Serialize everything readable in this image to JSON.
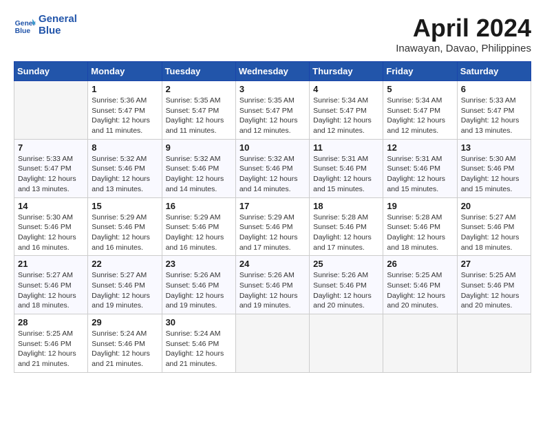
{
  "header": {
    "logo_line1": "General",
    "logo_line2": "Blue",
    "month": "April 2024",
    "location": "Inawayan, Davao, Philippines"
  },
  "weekdays": [
    "Sunday",
    "Monday",
    "Tuesday",
    "Wednesday",
    "Thursday",
    "Friday",
    "Saturday"
  ],
  "weeks": [
    [
      {
        "day": "",
        "empty": true
      },
      {
        "day": "1",
        "sunrise": "5:36 AM",
        "sunset": "5:47 PM",
        "daylight": "12 hours and 11 minutes."
      },
      {
        "day": "2",
        "sunrise": "5:35 AM",
        "sunset": "5:47 PM",
        "daylight": "12 hours and 11 minutes."
      },
      {
        "day": "3",
        "sunrise": "5:35 AM",
        "sunset": "5:47 PM",
        "daylight": "12 hours and 12 minutes."
      },
      {
        "day": "4",
        "sunrise": "5:34 AM",
        "sunset": "5:47 PM",
        "daylight": "12 hours and 12 minutes."
      },
      {
        "day": "5",
        "sunrise": "5:34 AM",
        "sunset": "5:47 PM",
        "daylight": "12 hours and 12 minutes."
      },
      {
        "day": "6",
        "sunrise": "5:33 AM",
        "sunset": "5:47 PM",
        "daylight": "12 hours and 13 minutes."
      }
    ],
    [
      {
        "day": "7",
        "sunrise": "5:33 AM",
        "sunset": "5:47 PM",
        "daylight": "12 hours and 13 minutes."
      },
      {
        "day": "8",
        "sunrise": "5:32 AM",
        "sunset": "5:46 PM",
        "daylight": "12 hours and 13 minutes."
      },
      {
        "day": "9",
        "sunrise": "5:32 AM",
        "sunset": "5:46 PM",
        "daylight": "12 hours and 14 minutes."
      },
      {
        "day": "10",
        "sunrise": "5:32 AM",
        "sunset": "5:46 PM",
        "daylight": "12 hours and 14 minutes."
      },
      {
        "day": "11",
        "sunrise": "5:31 AM",
        "sunset": "5:46 PM",
        "daylight": "12 hours and 15 minutes."
      },
      {
        "day": "12",
        "sunrise": "5:31 AM",
        "sunset": "5:46 PM",
        "daylight": "12 hours and 15 minutes."
      },
      {
        "day": "13",
        "sunrise": "5:30 AM",
        "sunset": "5:46 PM",
        "daylight": "12 hours and 15 minutes."
      }
    ],
    [
      {
        "day": "14",
        "sunrise": "5:30 AM",
        "sunset": "5:46 PM",
        "daylight": "12 hours and 16 minutes."
      },
      {
        "day": "15",
        "sunrise": "5:29 AM",
        "sunset": "5:46 PM",
        "daylight": "12 hours and 16 minutes."
      },
      {
        "day": "16",
        "sunrise": "5:29 AM",
        "sunset": "5:46 PM",
        "daylight": "12 hours and 16 minutes."
      },
      {
        "day": "17",
        "sunrise": "5:29 AM",
        "sunset": "5:46 PM",
        "daylight": "12 hours and 17 minutes."
      },
      {
        "day": "18",
        "sunrise": "5:28 AM",
        "sunset": "5:46 PM",
        "daylight": "12 hours and 17 minutes."
      },
      {
        "day": "19",
        "sunrise": "5:28 AM",
        "sunset": "5:46 PM",
        "daylight": "12 hours and 18 minutes."
      },
      {
        "day": "20",
        "sunrise": "5:27 AM",
        "sunset": "5:46 PM",
        "daylight": "12 hours and 18 minutes."
      }
    ],
    [
      {
        "day": "21",
        "sunrise": "5:27 AM",
        "sunset": "5:46 PM",
        "daylight": "12 hours and 18 minutes."
      },
      {
        "day": "22",
        "sunrise": "5:27 AM",
        "sunset": "5:46 PM",
        "daylight": "12 hours and 19 minutes."
      },
      {
        "day": "23",
        "sunrise": "5:26 AM",
        "sunset": "5:46 PM",
        "daylight": "12 hours and 19 minutes."
      },
      {
        "day": "24",
        "sunrise": "5:26 AM",
        "sunset": "5:46 PM",
        "daylight": "12 hours and 19 minutes."
      },
      {
        "day": "25",
        "sunrise": "5:26 AM",
        "sunset": "5:46 PM",
        "daylight": "12 hours and 20 minutes."
      },
      {
        "day": "26",
        "sunrise": "5:25 AM",
        "sunset": "5:46 PM",
        "daylight": "12 hours and 20 minutes."
      },
      {
        "day": "27",
        "sunrise": "5:25 AM",
        "sunset": "5:46 PM",
        "daylight": "12 hours and 20 minutes."
      }
    ],
    [
      {
        "day": "28",
        "sunrise": "5:25 AM",
        "sunset": "5:46 PM",
        "daylight": "12 hours and 21 minutes."
      },
      {
        "day": "29",
        "sunrise": "5:24 AM",
        "sunset": "5:46 PM",
        "daylight": "12 hours and 21 minutes."
      },
      {
        "day": "30",
        "sunrise": "5:24 AM",
        "sunset": "5:46 PM",
        "daylight": "12 hours and 21 minutes."
      },
      {
        "day": "",
        "empty": true
      },
      {
        "day": "",
        "empty": true
      },
      {
        "day": "",
        "empty": true
      },
      {
        "day": "",
        "empty": true
      }
    ]
  ],
  "labels": {
    "sunrise": "Sunrise:",
    "sunset": "Sunset:",
    "daylight": "Daylight:"
  }
}
